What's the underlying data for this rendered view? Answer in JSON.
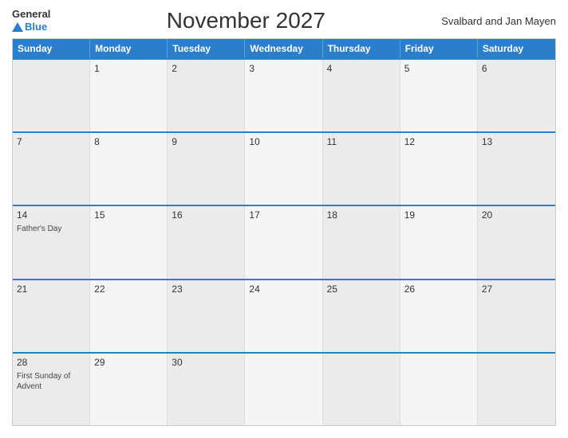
{
  "logo": {
    "general": "General",
    "blue": "Blue"
  },
  "title": "November 2027",
  "region": "Svalbard and Jan Mayen",
  "days_of_week": [
    "Sunday",
    "Monday",
    "Tuesday",
    "Wednesday",
    "Thursday",
    "Friday",
    "Saturday"
  ],
  "weeks": [
    [
      {
        "num": "",
        "event": ""
      },
      {
        "num": "1",
        "event": ""
      },
      {
        "num": "2",
        "event": ""
      },
      {
        "num": "3",
        "event": ""
      },
      {
        "num": "4",
        "event": ""
      },
      {
        "num": "5",
        "event": ""
      },
      {
        "num": "6",
        "event": ""
      }
    ],
    [
      {
        "num": "7",
        "event": ""
      },
      {
        "num": "8",
        "event": ""
      },
      {
        "num": "9",
        "event": ""
      },
      {
        "num": "10",
        "event": ""
      },
      {
        "num": "11",
        "event": ""
      },
      {
        "num": "12",
        "event": ""
      },
      {
        "num": "13",
        "event": ""
      }
    ],
    [
      {
        "num": "14",
        "event": "Father's Day"
      },
      {
        "num": "15",
        "event": ""
      },
      {
        "num": "16",
        "event": ""
      },
      {
        "num": "17",
        "event": ""
      },
      {
        "num": "18",
        "event": ""
      },
      {
        "num": "19",
        "event": ""
      },
      {
        "num": "20",
        "event": ""
      }
    ],
    [
      {
        "num": "21",
        "event": ""
      },
      {
        "num": "22",
        "event": ""
      },
      {
        "num": "23",
        "event": ""
      },
      {
        "num": "24",
        "event": ""
      },
      {
        "num": "25",
        "event": ""
      },
      {
        "num": "26",
        "event": ""
      },
      {
        "num": "27",
        "event": ""
      }
    ],
    [
      {
        "num": "28",
        "event": "First Sunday of Advent"
      },
      {
        "num": "29",
        "event": ""
      },
      {
        "num": "30",
        "event": ""
      },
      {
        "num": "",
        "event": ""
      },
      {
        "num": "",
        "event": ""
      },
      {
        "num": "",
        "event": ""
      },
      {
        "num": "",
        "event": ""
      }
    ]
  ]
}
